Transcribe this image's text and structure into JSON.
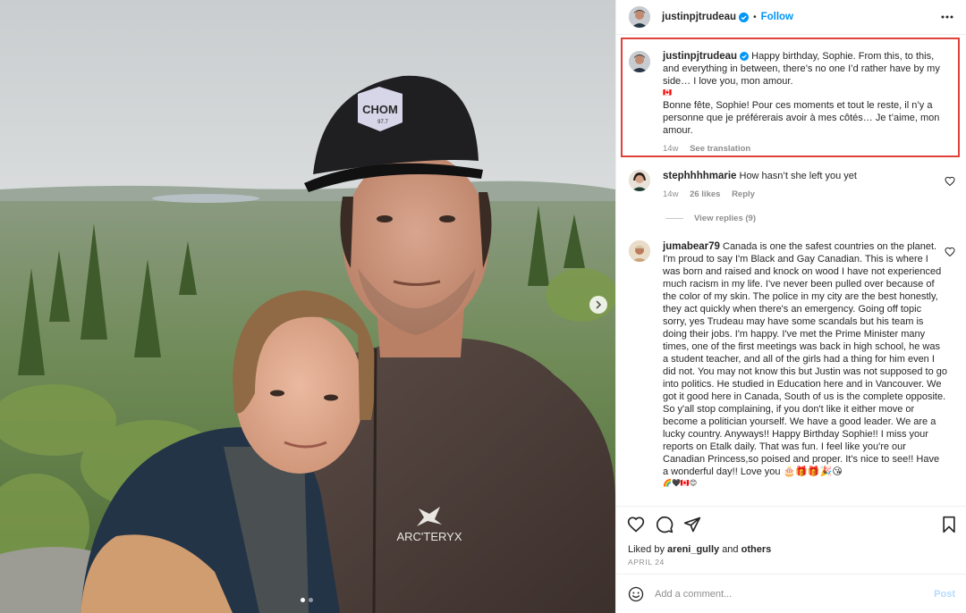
{
  "post": {
    "author": "justinpjtrudeau",
    "follow_label": "Follow",
    "separator": "•",
    "caption": {
      "en": "Happy birthday, Sophie. From this, to this, and everything in between, there’s no one I’d rather have by my side… I love you, mon amour.",
      "flag": "🇨🇦",
      "fr": "Bonne fête, Sophie! Pour ces moments et tout le reste, il n’y a personne que je préférerais avoir à mes côtés… Je t’aime, mon amour.",
      "age": "14w",
      "see_translation": "See translation"
    },
    "photo": {
      "cap_text": "CHOM",
      "cap_subtext": "97.7",
      "jacket_brand": "ARC'TERYX"
    }
  },
  "comments": [
    {
      "username": "stephhhhmarie",
      "text": "How hasn’t she left you yet",
      "age": "14w",
      "likes": "26 likes",
      "reply_label": "Reply",
      "view_replies": "View replies (9)"
    },
    {
      "username": "jumabear79",
      "text": "Canada is one the safest countries on the planet. I'm proud to say I'm Black and Gay Canadian. This is where I was born and raised and knock on wood I have not experienced much racism in my life. I've never been pulled over because of the color of my skin. The police in my city are the best honestly, they act quickly when there's an emergency. Going off topic sorry, yes Trudeau may have some scandals but his team is doing their jobs. I'm happy. I've met the Prime Minister many times, one of the first meetings was back in high school, he was a student teacher, and all of the girls had a thing for him even I did not. You may not know this but Justin was not supposed to go into politics. He studied in Education here and in Vancouver. We got it good here in Canada, South of us is the complete opposite. So y'all stop complaining, if you don't like it either move or become a politician yourself. We have a good leader. We are a lucky country. Anyways!! Happy Birthday Sophie!! I miss your reports on Etalk daily. That was fun. I feel like you're our Canadian Princess,so poised and proper. It's nice to see!! Have a wonderful day!! Love you 🎂🎁🎁🎉😘",
      "text_emoji_line": "🌈🖤🇨🇦😊"
    }
  ],
  "likes_line": {
    "prefix": "Liked by",
    "user": "areni_gully",
    "joiner": "and",
    "others": "others"
  },
  "date": "APRIL 24",
  "add_comment": {
    "placeholder": "Add a comment...",
    "post_label": "Post"
  },
  "icons": {
    "verified": "verified-badge-icon",
    "more": "more-options-icon",
    "like": "heart-icon",
    "comment": "comment-bubble-icon",
    "share": "paper-plane-icon",
    "save": "bookmark-icon",
    "emoji": "smiley-face-icon",
    "next": "chevron-right-icon"
  },
  "colors": {
    "accent": "#0095f6",
    "highlight_border": "#e0413a",
    "muted_text": "#8e8e8e",
    "post_disabled": "#b3dbff"
  },
  "carousel": {
    "slides": 2,
    "active": 1
  }
}
